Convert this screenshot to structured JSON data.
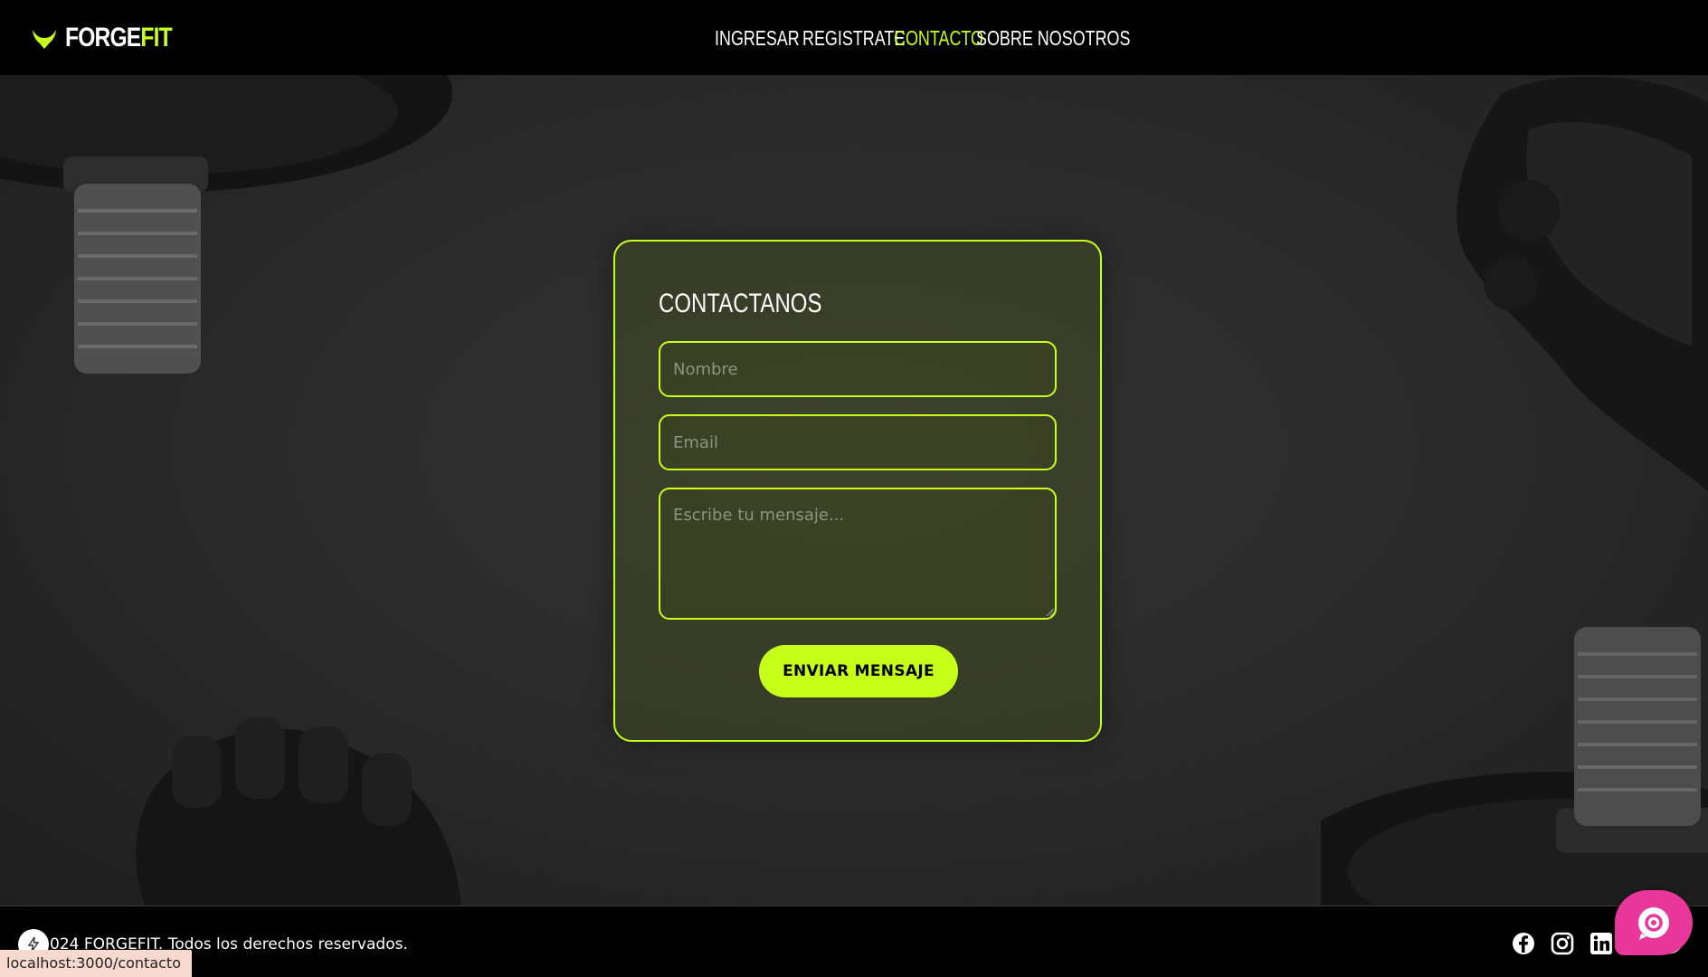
{
  "header": {
    "logo": {
      "part1": "FORGE",
      "part2": "FIT",
      "icon": "horns-icon"
    },
    "nav": [
      {
        "label": "INGRESAR",
        "active": false
      },
      {
        "label": "REGISTRATE",
        "active": false
      },
      {
        "label": "CONTACTO",
        "active": true
      },
      {
        "label": "SOBRE NOSOTROS",
        "active": false
      }
    ]
  },
  "contact": {
    "title": "CONTACTANOS",
    "name_placeholder": "Nombre",
    "email_placeholder": "Email",
    "message_placeholder": "Escribe tu mensaje...",
    "submit_label": "ENVIAR MENSAJE"
  },
  "footer": {
    "copyright": "024 FORGEFIT. Todos los derechos reservados.",
    "social": [
      "facebook-icon",
      "instagram-icon",
      "linkedin-icon",
      "twitter-icon"
    ]
  },
  "status": {
    "url": "localhost:3000/contacto"
  },
  "colors": {
    "accent": "#c6ff1a",
    "background": "#000000",
    "help_bubble": "#e8369a"
  }
}
